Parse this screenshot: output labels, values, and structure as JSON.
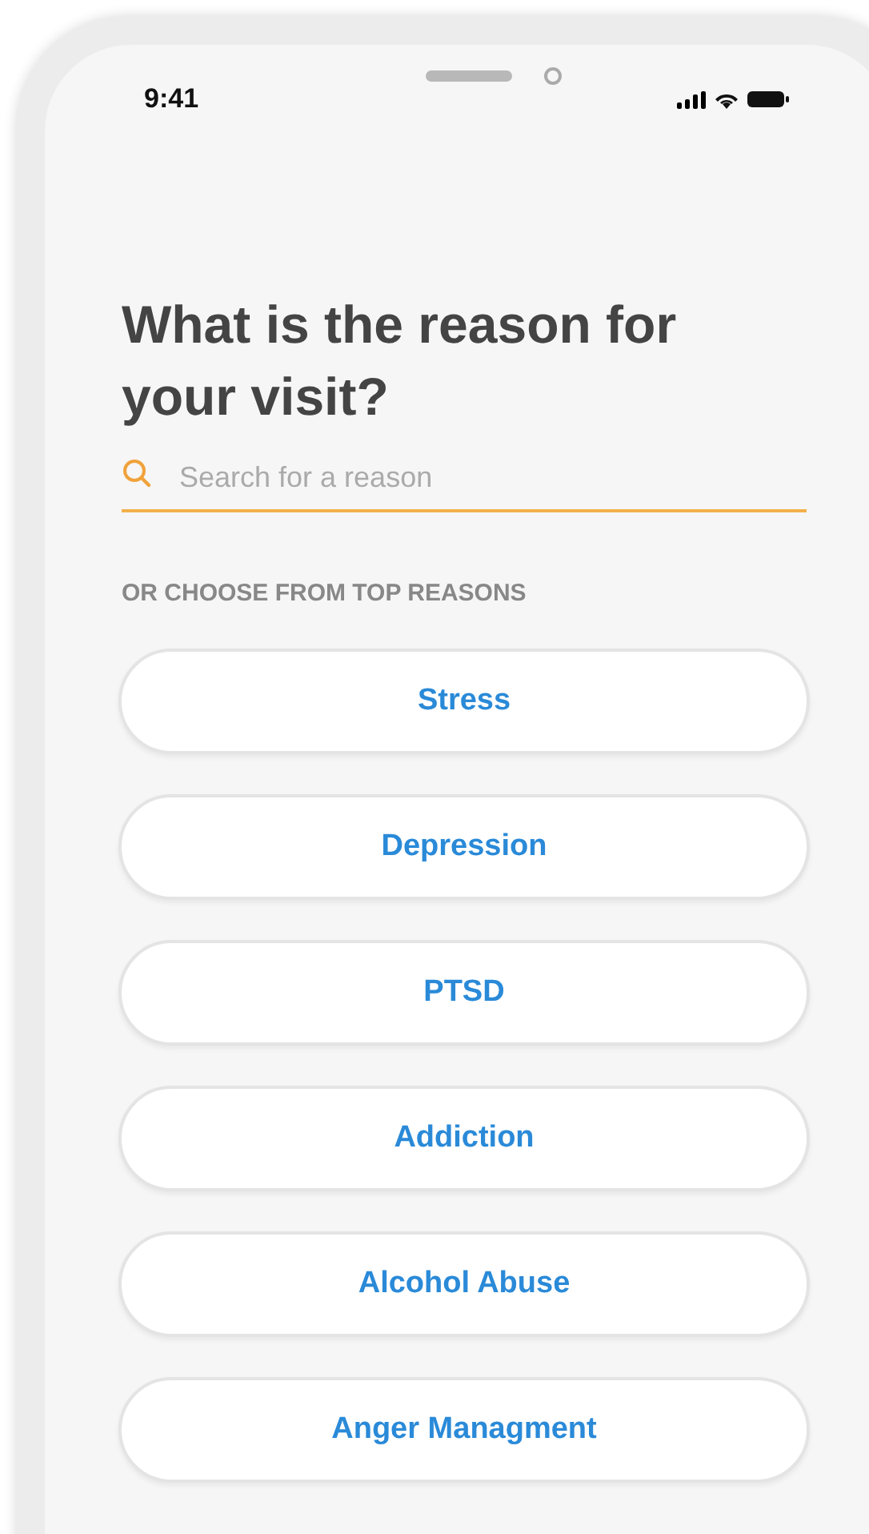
{
  "status_bar": {
    "time": "9:41"
  },
  "title": "What is the reason for your visit?",
  "search": {
    "placeholder": "Search for a reason"
  },
  "section_label": "OR CHOOSE FROM TOP REASONS",
  "reasons": [
    {
      "label": "Stress"
    },
    {
      "label": "Depression"
    },
    {
      "label": "PTSD"
    },
    {
      "label": "Addiction"
    },
    {
      "label": "Alcohol Abuse"
    },
    {
      "label": "Anger Managment"
    }
  ]
}
